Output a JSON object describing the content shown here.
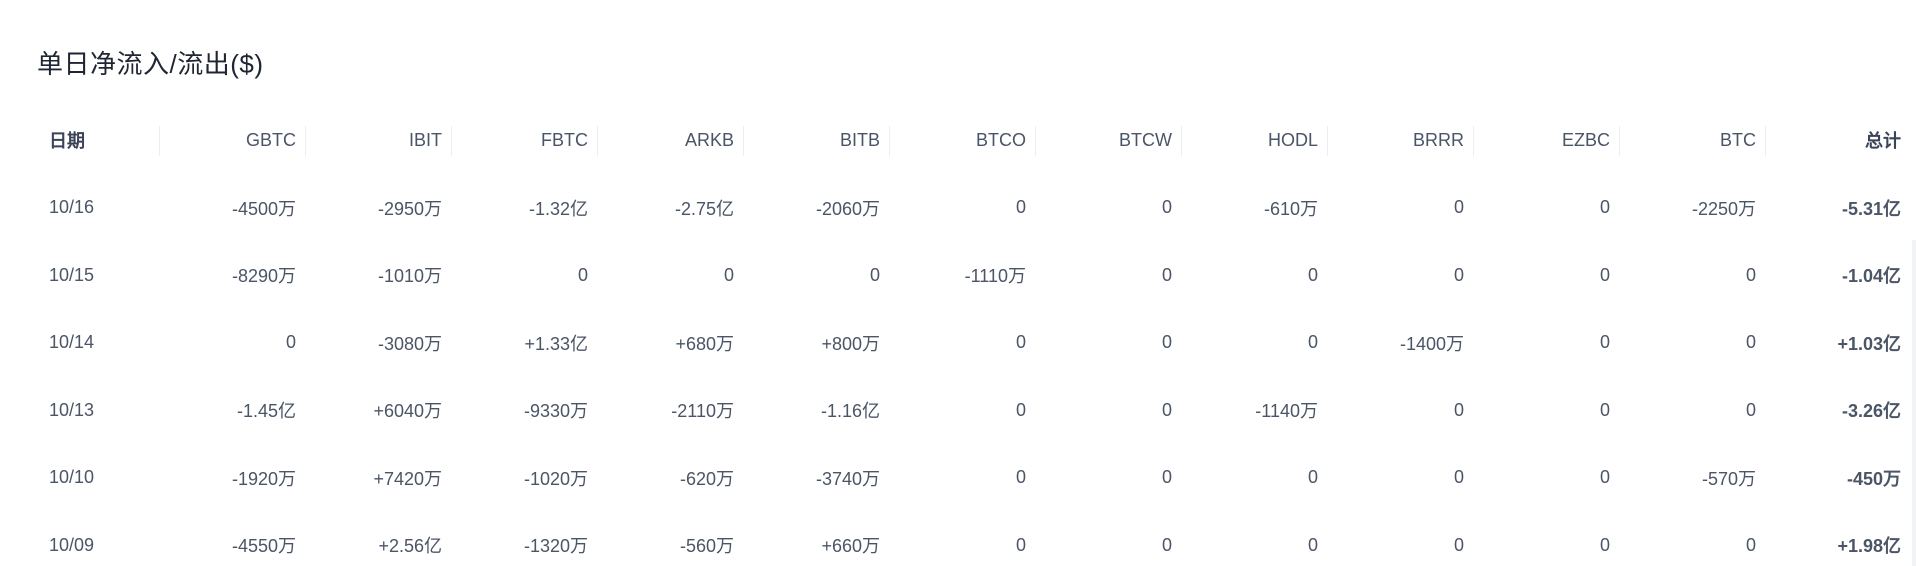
{
  "title": "单日净流入/流出($)",
  "colors": {
    "negative": "#e84a55",
    "positive": "#17a673",
    "neutral": "#4b5566"
  },
  "table": {
    "columns": [
      "日期",
      "GBTC",
      "IBIT",
      "FBTC",
      "ARKB",
      "BITB",
      "BTCO",
      "BTCW",
      "HODL",
      "BRRR",
      "EZBC",
      "BTC",
      "总计"
    ],
    "rows": [
      [
        "10/16",
        "-4500万",
        "-2950万",
        "-1.32亿",
        "-2.75亿",
        "-2060万",
        "0",
        "0",
        "-610万",
        "0",
        "0",
        "-2250万",
        "-5.31亿"
      ],
      [
        "10/15",
        "-8290万",
        "-1010万",
        "0",
        "0",
        "0",
        "-1110万",
        "0",
        "0",
        "0",
        "0",
        "0",
        "-1.04亿"
      ],
      [
        "10/14",
        "0",
        "-3080万",
        "+1.33亿",
        "+680万",
        "+800万",
        "0",
        "0",
        "0",
        "-1400万",
        "0",
        "0",
        "+1.03亿"
      ],
      [
        "10/13",
        "-1.45亿",
        "+6040万",
        "-9330万",
        "-2110万",
        "-1.16亿",
        "0",
        "0",
        "-1140万",
        "0",
        "0",
        "0",
        "-3.26亿"
      ],
      [
        "10/10",
        "-1920万",
        "+7420万",
        "-1020万",
        "-620万",
        "-3740万",
        "0",
        "0",
        "0",
        "0",
        "0",
        "-570万",
        "-450万"
      ],
      [
        "10/09",
        "-4550万",
        "+2.56亿",
        "-1320万",
        "-560万",
        "+660万",
        "0",
        "0",
        "0",
        "0",
        "0",
        "0",
        "+1.98亿"
      ]
    ]
  }
}
